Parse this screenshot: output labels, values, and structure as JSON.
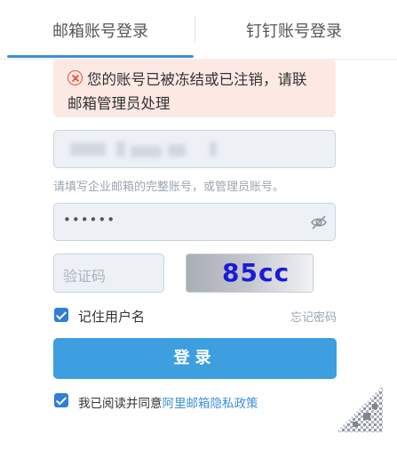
{
  "tabs": {
    "mail": "邮箱账号登录",
    "dingtalk": "钉钉账号登录"
  },
  "alert": {
    "line1": "您的账号已被冻结或已注销，请联",
    "line2": "邮箱管理员处理",
    "icon": "close-circle-icon"
  },
  "account": {
    "hint": "请填写企业邮箱的完整账号，或管理员账号。"
  },
  "password": {
    "value": "••••••",
    "icon": "eye-off-icon"
  },
  "captcha": {
    "placeholder": "验证码",
    "image_text": "85cc"
  },
  "remember": {
    "label": "记住用户名",
    "checked": true,
    "forgot": "忘记密码"
  },
  "login": {
    "label": "登录"
  },
  "agreement": {
    "checked": true,
    "prefix": "我已阅读并同意",
    "link": "阿里邮箱隐私政策"
  },
  "colors": {
    "accent": "#3d9ee0",
    "link": "#3d8fd6",
    "alert_bg": "#fde9e4",
    "alert_icon": "#e8523b",
    "captcha_text": "#1a1ad8"
  }
}
